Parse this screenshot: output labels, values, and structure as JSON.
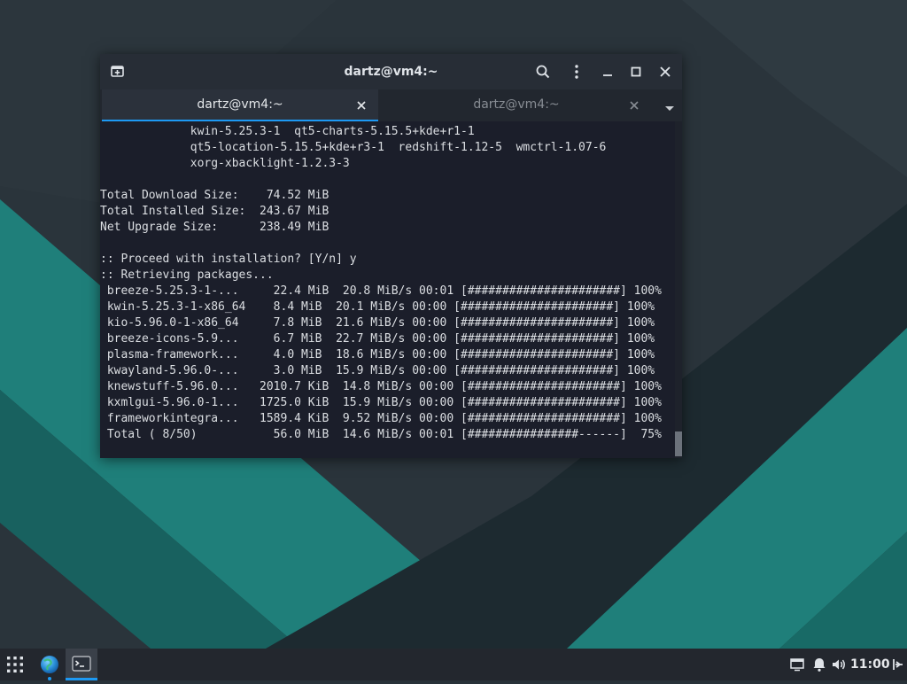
{
  "window": {
    "title": "dartz@vm4:~"
  },
  "tabs": [
    {
      "label": "dartz@vm4:~",
      "active": true
    },
    {
      "label": "dartz@vm4:~",
      "active": false
    }
  ],
  "terminal": {
    "lines": [
      "             kwin-5.25.3-1  qt5-charts-5.15.5+kde+r1-1",
      "             qt5-location-5.15.5+kde+r3-1  redshift-1.12-5  wmctrl-1.07-6",
      "             xorg-xbacklight-1.2.3-3",
      "",
      "Total Download Size:    74.52 MiB",
      "Total Installed Size:  243.67 MiB",
      "Net Upgrade Size:      238.49 MiB",
      "",
      ":: Proceed with installation? [Y/n] y",
      ":: Retrieving packages...",
      " breeze-5.25.3-1-...     22.4 MiB  20.8 MiB/s 00:01 [######################] 100%",
      " kwin-5.25.3-1-x86_64    8.4 MiB  20.1 MiB/s 00:00 [######################] 100%",
      " kio-5.96.0-1-x86_64     7.8 MiB  21.6 MiB/s 00:00 [######################] 100%",
      " breeze-icons-5.9...     6.7 MiB  22.7 MiB/s 00:00 [######################] 100%",
      " plasma-framework...     4.0 MiB  18.6 MiB/s 00:00 [######################] 100%",
      " kwayland-5.96.0-...     3.0 MiB  15.9 MiB/s 00:00 [######################] 100%",
      " knewstuff-5.96.0...   2010.7 KiB  14.8 MiB/s 00:00 [######################] 100%",
      " kxmlgui-5.96.0-1...   1725.0 KiB  15.9 MiB/s 00:00 [######################] 100%",
      " frameworkintegra...   1589.4 KiB  9.52 MiB/s 00:00 [######################] 100%",
      " Total ( 8/50)           56.0 MiB  14.6 MiB/s 00:01 [################------]  75%"
    ]
  },
  "taskbar": {
    "clock": "11:00",
    "items": [
      "app-launcher",
      "web-browser",
      "terminal"
    ],
    "tray": [
      "network-icon",
      "notifications-icon",
      "volume-icon",
      "power-icon"
    ]
  },
  "colors": {
    "accent": "#1d99f3",
    "terminal_bg": "#1b1e2a",
    "desktop_teal": "#1f7f7a"
  }
}
